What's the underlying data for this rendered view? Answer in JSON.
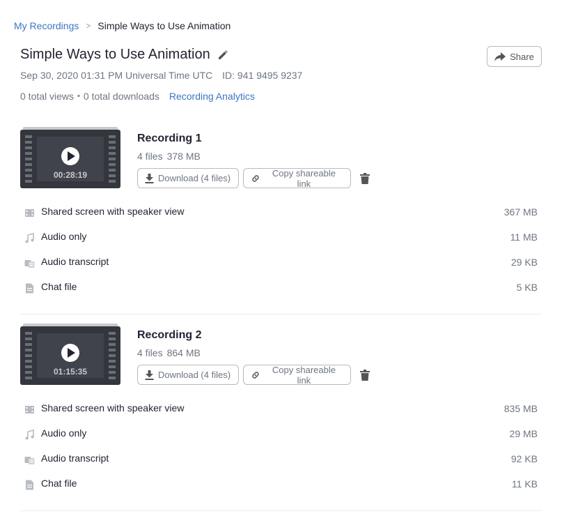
{
  "breadcrumb": {
    "root": "My Recordings",
    "separator": ">",
    "current": "Simple Ways to Use Animation"
  },
  "header": {
    "title": "Simple Ways to Use Animation",
    "share_label": "Share",
    "datetime": "Sep 30, 2020 01:31 PM Universal Time UTC",
    "meeting_id": "ID: 941 9495 9237",
    "views": "0 total views",
    "stats_separator": "•",
    "downloads": "0 total downloads",
    "analytics_link": "Recording Analytics"
  },
  "recordings": [
    {
      "name": "Recording 1",
      "files_count": "4 files",
      "total_size": "378 MB",
      "duration": "00:28:19",
      "download_label": "Download (4 files)",
      "copy_label": "Copy shareable link",
      "files": [
        {
          "icon": "video-icon",
          "name": "Shared screen with speaker view",
          "size": "367 MB"
        },
        {
          "icon": "audio-icon",
          "name": "Audio only",
          "size": "11 MB"
        },
        {
          "icon": "transcript-icon",
          "name": "Audio transcript",
          "size": "29 KB"
        },
        {
          "icon": "chat-file-icon",
          "name": "Chat file",
          "size": "5 KB"
        }
      ]
    },
    {
      "name": "Recording 2",
      "files_count": "4 files",
      "total_size": "864 MB",
      "duration": "01:15:35",
      "download_label": "Download (4 files)",
      "copy_label": "Copy shareable link",
      "files": [
        {
          "icon": "video-icon",
          "name": "Shared screen with speaker view",
          "size": "835 MB"
        },
        {
          "icon": "audio-icon",
          "name": "Audio only",
          "size": "29 MB"
        },
        {
          "icon": "transcript-icon",
          "name": "Audio transcript",
          "size": "92 KB"
        },
        {
          "icon": "chat-file-icon",
          "name": "Chat file",
          "size": "11 KB"
        }
      ]
    }
  ],
  "colors": {
    "link": "#3a75c4",
    "text": "#232333",
    "muted": "#6e7680",
    "thumbnail_bg": "#34363d"
  }
}
